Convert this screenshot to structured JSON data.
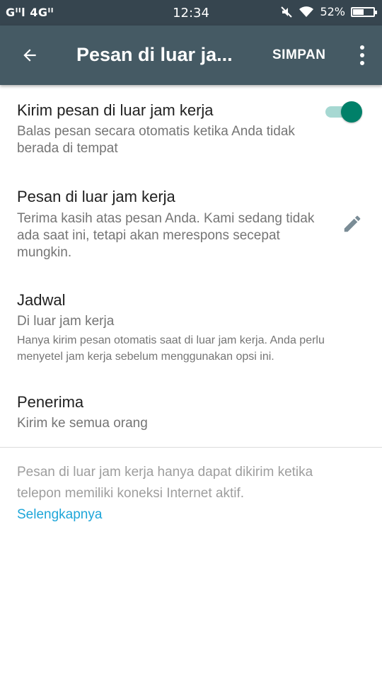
{
  "status_bar": {
    "carrier": "Gᴵᴵl 4Gᴵᴵ",
    "time": "12:34",
    "battery_percent": "52%",
    "battery_level": 0.52
  },
  "app_bar": {
    "back_icon": "arrow-left-icon",
    "title": "Pesan di luar ja...",
    "save_label": "SIMPAN",
    "more_icon": "more-vert-icon"
  },
  "settings": {
    "send_away": {
      "title": "Kirim pesan di luar jam kerja",
      "subtitle": "Balas pesan secara otomatis ketika Anda tidak berada di tempat",
      "toggle_on": true
    },
    "away_message": {
      "title": "Pesan di luar jam kerja",
      "subtitle": "Terima kasih atas pesan Anda. Kami sedang tidak ada saat ini, tetapi akan merespons secepat mungkin.",
      "edit_icon": "pencil-icon"
    },
    "schedule": {
      "title": "Jadwal",
      "value": "Di luar jam kerja",
      "note": "Hanya kirim pesan otomatis saat di luar jam kerja. Anda perlu menyetel jam kerja sebelum menggunakan opsi ini."
    },
    "recipients": {
      "title": "Penerima",
      "value": "Kirim ke semua orang"
    }
  },
  "footer": {
    "info": "Pesan di luar jam kerja hanya dapat dikirim ketika telepon memiliki koneksi Internet aktif.",
    "learn_more": "Selengkapnya"
  },
  "colors": {
    "app_bar": "#455a64",
    "status_bar": "#36454f",
    "toggle_thumb": "#008069",
    "toggle_track": "#a6d8d2",
    "link": "#1ea6d9"
  }
}
